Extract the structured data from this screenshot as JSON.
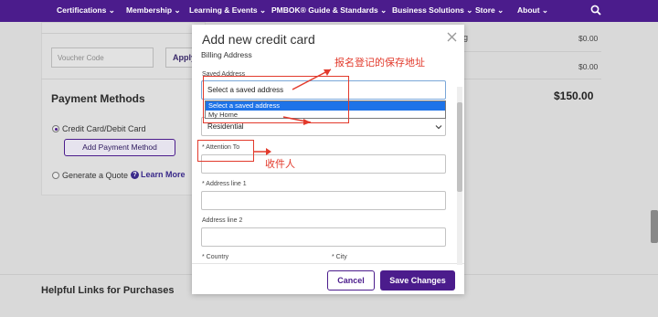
{
  "nav": {
    "items": [
      "Certifications",
      "Membership",
      "Learning & Events",
      "PMBOK® Guide & Standards",
      "Business Solutions",
      "Store",
      "About"
    ],
    "search_icon": "search-icon",
    "color": "#4b1c8c"
  },
  "cart": {
    "voucher_placeholder": "Voucher Code",
    "apply_label": "Apply",
    "payment_methods_title": "Payment Methods",
    "credit_card_label": "Credit Card/Debit Card",
    "add_payment_label": "Add Payment Method",
    "generate_quote_label": "Generate a Quote",
    "learn_more_label": "Learn More",
    "summary_partial_label": "g",
    "summary_amount_1": "$0.00",
    "summary_amount_2": "$0.00",
    "total": "$150.00",
    "helpful_links": "Helpful Links for Purchases"
  },
  "modal": {
    "title": "Add new credit card",
    "section": "Billing Address",
    "saved_address_label": "Saved Address",
    "saved_address_value": "Select a saved address",
    "saved_address_options": [
      "Select a saved address",
      "My Home"
    ],
    "address_type_value": "Residential",
    "attention_label": "* Attention To",
    "address1_label": "* Address line 1",
    "address2_label": "Address line 2",
    "country_label": "* Country",
    "city_label": "* City",
    "cancel_label": "Cancel",
    "save_label": "Save Changes"
  },
  "annotations": {
    "saved_address_note": "报名登记的保存地址",
    "recipient_note": "收件人",
    "color": "#e23a2c"
  }
}
